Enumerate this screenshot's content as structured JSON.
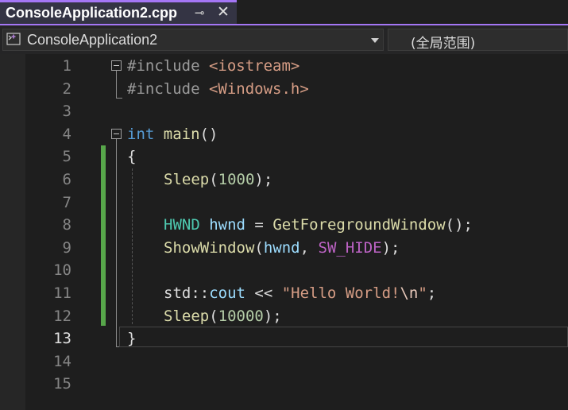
{
  "tab": {
    "title": "ConsoleApplication2.cpp",
    "pin_glyph": "⊸",
    "close_glyph": "✕"
  },
  "navbar": {
    "project": "ConsoleApplication2",
    "scope": "(全局范围)"
  },
  "editor": {
    "line_numbers": [
      "1",
      "2",
      "3",
      "4",
      "5",
      "6",
      "7",
      "8",
      "9",
      "10",
      "11",
      "12",
      "13",
      "14",
      "15"
    ],
    "current_line": "13",
    "lines": {
      "l1": {
        "directive": "#include",
        "header": "<iostream>"
      },
      "l2": {
        "directive": "#include",
        "header": "<Windows.h>"
      },
      "l4": {
        "type": "int",
        "name": "main",
        "parens": "()"
      },
      "l5": {
        "brace": "{"
      },
      "l6": {
        "func": "Sleep",
        "open": "(",
        "arg": "1000",
        "close": ");"
      },
      "l8": {
        "type": "HWND",
        "var": "hwnd",
        "eq": " = ",
        "func": "GetForegroundWindow",
        "rest": "();"
      },
      "l9": {
        "func": "ShowWindow",
        "open": "(",
        "var": "hwnd",
        "comma": ", ",
        "macro": "SW_HIDE",
        "close": ");"
      },
      "l11": {
        "ns": "std::",
        "var": "cout",
        "op": " << ",
        "str1": "\"Hello World!",
        "esc": "\\n",
        "str2": "\"",
        "end": ";"
      },
      "l12": {
        "func": "Sleep",
        "open": "(",
        "arg": "10000",
        "close": ");"
      },
      "l13": {
        "brace": "}"
      }
    }
  },
  "colors": {
    "accent": "#a476f5",
    "change_bar": "#57a64a",
    "keyword": "#569cd6",
    "string": "#d69d85"
  }
}
